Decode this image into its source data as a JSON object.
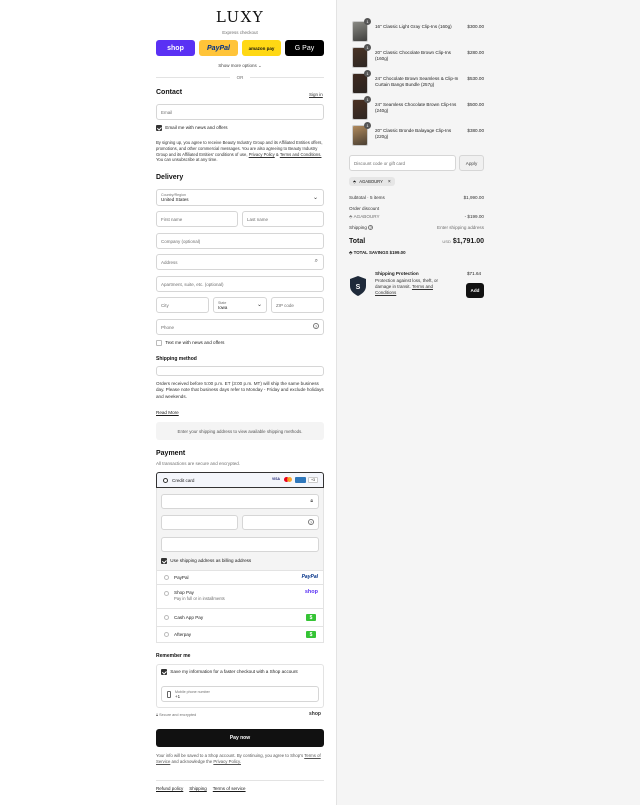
{
  "brand": {
    "logo": "LUXY"
  },
  "express": {
    "title": "Express checkout",
    "buttons": [
      {
        "label": "shop",
        "bg": "#5a31f4",
        "fg": "#ffffff"
      },
      {
        "label": "PayPal",
        "bg": "#ffc439",
        "fg": "#003087"
      },
      {
        "label": "amazon pay",
        "bg": "#ffd814",
        "fg": "#111111"
      },
      {
        "label": "G Pay",
        "bg": "#000000",
        "fg": "#ffffff"
      }
    ],
    "show_more": "Show more options",
    "or": "OR"
  },
  "contact": {
    "title": "Contact",
    "sign_in": "Sign in",
    "email_placeholder": "Email",
    "email_news": "Email me with news and offers",
    "consent": {
      "text": "By signing up, you agree to receive Beauty Industry Group and its Affiliated Entities offers, promotions, and other commercial messages. You are also agreeing to Beauty Industry Group and its Affiliated Entities' conditions of use,",
      "privacy": "Privacy Policy",
      "amp": "&",
      "terms": "Terms and Conditions.",
      "tail": "You can unsubscribe at any time."
    }
  },
  "delivery": {
    "title": "Delivery",
    "country_label": "Country/Region",
    "country_value": "United States",
    "first_name": "First name",
    "last_name": "Last name",
    "company": "Company (optional)",
    "address": "Address",
    "apartment": "Apartment, suite, etc. (optional)",
    "city": "City",
    "state_label": "State",
    "state_value": "Iowa",
    "zip": "ZIP code",
    "phone": "Phone",
    "text_news": "Text me with news and offers"
  },
  "shipping": {
    "title": "Shipping method",
    "note": "Orders received before 5:00 p.m. ET (3:00 p.m. MT) will ship the same business day. Please note that business days refer to Monday - Friday and exclude holidays and weekends.",
    "read_more": "Read More",
    "placeholder": "Enter your shipping address to view available shipping methods."
  },
  "payment": {
    "title": "Payment",
    "subtitle": "All transactions are secure and encrypted.",
    "credit_card": "Credit card",
    "card_badges": [
      "VISA",
      "MC",
      "AMEX",
      "+3"
    ],
    "billing_same": "Use shipping address as billing address",
    "methods": [
      {
        "label": "PayPal",
        "sub": "",
        "logo": "PayPal"
      },
      {
        "label": "Shop Pay",
        "sub": "Pay in full or in installments",
        "logo": "shop"
      },
      {
        "label": "Cash App Pay",
        "sub": "",
        "logo": "$"
      },
      {
        "label": "Afterpay",
        "sub": "",
        "logo": "$"
      }
    ]
  },
  "remember": {
    "title": "Remember me",
    "save_info": "Save my information for a faster checkout with a Shop account",
    "mobile_label": "Mobile phone number",
    "mobile_value": "+1",
    "secure": "Secure and encrypted",
    "shop_logo": "shop"
  },
  "pay_now": "Pay now",
  "disclaimer": {
    "text": "Your info will be saved to a Shop account. By continuing, you agree to Shop's",
    "tos": "Terms of Service",
    "and": "and acknowledge the",
    "privacy": "Privacy Policy."
  },
  "footer_links": [
    "Refund policy",
    "Shipping",
    "Terms of service"
  ],
  "cart": {
    "items": [
      {
        "qty": "1",
        "name": "16\" Classic Light Gray Clip-Ins (160g)",
        "price": "$300.00",
        "color": "#8a8a84"
      },
      {
        "qty": "1",
        "name": "20\" Classic Chocolate Brown Clip-Ins (160g)",
        "price": "$280.00",
        "color": "#4a3426"
      },
      {
        "qty": "1",
        "name": "24\" Chocolate Brown Seamless & Clip-In Curtain Bangs Bundle (257g)",
        "price": "$530.00",
        "color": "#3f2a1f"
      },
      {
        "qty": "1",
        "name": "24\" Seamless Chocolate Brown Clip-Ins (240g)",
        "price": "$500.00",
        "color": "#4b3122"
      },
      {
        "qty": "1",
        "name": "20\" Classic Bronde Balayage Clip-Ins (220g)",
        "price": "$380.00",
        "color": "#b08a5c"
      }
    ],
    "discount_placeholder": "Discount code or gift card",
    "apply": "Apply",
    "code_tag": "AGABOURY",
    "subtotal_label": "Subtotal · 5 items",
    "subtotal": "$1,990.00",
    "order_discount": "Order discount",
    "discount_code": "AGABOURY",
    "discount_amount": "- $199.00",
    "shipping_label": "Shipping",
    "shipping_value": "Enter shipping address",
    "total_label": "Total",
    "currency": "USD",
    "total": "$1,791.00",
    "savings_label": "TOTAL SAVINGS",
    "savings": "$199.00",
    "protection": {
      "title": "Shipping Protection",
      "desc": "Protection against loss, theft, or damage in transit.",
      "link": "Terms and Conditions",
      "price": "$71.64",
      "add": "Add"
    }
  }
}
